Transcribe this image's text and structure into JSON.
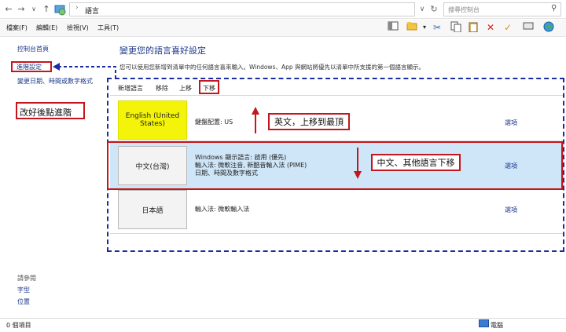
{
  "address": {
    "path": "語言",
    "search_placeholder": "搜尋控制台"
  },
  "menu": [
    "檔案(F)",
    "編輯(E)",
    "檢視(V)",
    "工具(T)"
  ],
  "sidebar": {
    "links": [
      "控制台首頁",
      "進階設定",
      "變更日期、時間或數字格式"
    ],
    "see_also_title": "請參閱",
    "see_also": [
      "字型",
      "位置"
    ],
    "note": "改好後點進階"
  },
  "main": {
    "title": "變更您的語言喜好設定",
    "description": "您可以使用您新增到清單中的任何語言喜來輸入。Windows、App 與網站將優先以清單中所支援的第一個語言顯示。",
    "toolbar": [
      "新增語言",
      "移除",
      "上移",
      "下移"
    ],
    "languages": [
      {
        "name": "English (United States)",
        "info": [
          "鍵盤配置: US"
        ],
        "option": "選項"
      },
      {
        "name": "中文(台灣)",
        "info": [
          "Windows 顯示語言: 啟用 (優先)",
          "輸入法: 微軟注音, 新酷音輸入法 (PIME)",
          "日期、時間及數字格式"
        ],
        "option": "選項"
      },
      {
        "name": "日本語",
        "info": [
          "輸入法: 微軟輸入法"
        ],
        "option": "選項"
      }
    ],
    "callout_up": "英文，上移到最頂",
    "callout_down": "中文、其他語言下移"
  },
  "status": {
    "items": "0 個項目",
    "computer": "電腦"
  },
  "colors": {
    "annotation_red": "#c4161c",
    "annotation_blue": "#1b2ca0",
    "highlight_yellow": "#f4f40a",
    "selected_row": "#cfe6f8"
  },
  "icons": [
    "back-arrow-icon",
    "forward-arrow-icon",
    "recent-dropdown-icon",
    "up-arrow-icon",
    "control-panel-icon",
    "search-icon",
    "refresh-icon"
  ]
}
